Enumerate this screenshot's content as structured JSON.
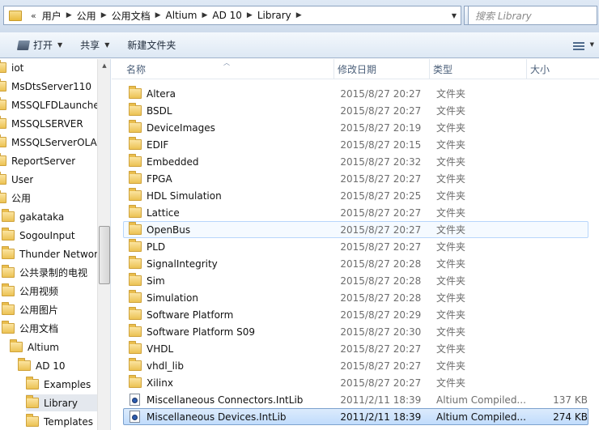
{
  "address_bar": {
    "overflow": "«",
    "breadcrumbs": [
      "用户",
      "公用",
      "公用文档",
      "Altium",
      "AD 10",
      "Library"
    ]
  },
  "search": {
    "placeholder": "搜索 Library"
  },
  "toolbar": {
    "open_label": "打开",
    "share_label": "共享",
    "new_folder_label": "新建文件夹"
  },
  "navigation": {
    "items": [
      {
        "label": "iot",
        "indent": 0,
        "selected": false
      },
      {
        "label": "MsDtsServer110",
        "indent": 0,
        "selected": false
      },
      {
        "label": "MSSQLFDLauncher",
        "indent": 0,
        "selected": false
      },
      {
        "label": "MSSQLSERVER",
        "indent": 0,
        "selected": false
      },
      {
        "label": "MSSQLServerOLAP",
        "indent": 0,
        "selected": false
      },
      {
        "label": "ReportServer",
        "indent": 0,
        "selected": false
      },
      {
        "label": "User",
        "indent": 0,
        "selected": false
      },
      {
        "label": "公用",
        "indent": 0,
        "selected": false
      },
      {
        "label": "gakataka",
        "indent": 1,
        "selected": false
      },
      {
        "label": "SogouInput",
        "indent": 1,
        "selected": false
      },
      {
        "label": "Thunder Network",
        "indent": 1,
        "selected": false
      },
      {
        "label": "公共录制的电视",
        "indent": 1,
        "selected": false
      },
      {
        "label": "公用视频",
        "indent": 1,
        "selected": false
      },
      {
        "label": "公用图片",
        "indent": 1,
        "selected": false
      },
      {
        "label": "公用文档",
        "indent": 1,
        "selected": false
      },
      {
        "label": "Altium",
        "indent": 2,
        "selected": false
      },
      {
        "label": "AD 10",
        "indent": 3,
        "selected": false
      },
      {
        "label": "Examples",
        "indent": 4,
        "selected": false
      },
      {
        "label": "Library",
        "indent": 4,
        "selected": true
      },
      {
        "label": "Templates",
        "indent": 4,
        "selected": false
      }
    ]
  },
  "columns": {
    "name": "名称",
    "date": "修改日期",
    "type": "类型",
    "size": "大小"
  },
  "files": [
    {
      "name": "Altera",
      "date": "2015/8/27 20:27",
      "type": "文件夹",
      "size": "",
      "kind": "folder",
      "state": ""
    },
    {
      "name": "BSDL",
      "date": "2015/8/27 20:27",
      "type": "文件夹",
      "size": "",
      "kind": "folder",
      "state": ""
    },
    {
      "name": "DeviceImages",
      "date": "2015/8/27 20:19",
      "type": "文件夹",
      "size": "",
      "kind": "folder",
      "state": ""
    },
    {
      "name": "EDIF",
      "date": "2015/8/27 20:15",
      "type": "文件夹",
      "size": "",
      "kind": "folder",
      "state": ""
    },
    {
      "name": "Embedded",
      "date": "2015/8/27 20:32",
      "type": "文件夹",
      "size": "",
      "kind": "folder",
      "state": ""
    },
    {
      "name": "FPGA",
      "date": "2015/8/27 20:27",
      "type": "文件夹",
      "size": "",
      "kind": "folder",
      "state": ""
    },
    {
      "name": "HDL Simulation",
      "date": "2015/8/27 20:25",
      "type": "文件夹",
      "size": "",
      "kind": "folder",
      "state": ""
    },
    {
      "name": "Lattice",
      "date": "2015/8/27 20:27",
      "type": "文件夹",
      "size": "",
      "kind": "folder",
      "state": ""
    },
    {
      "name": "OpenBus",
      "date": "2015/8/27 20:27",
      "type": "文件夹",
      "size": "",
      "kind": "folder",
      "state": "hover"
    },
    {
      "name": "PLD",
      "date": "2015/8/27 20:27",
      "type": "文件夹",
      "size": "",
      "kind": "folder",
      "state": ""
    },
    {
      "name": "SignalIntegrity",
      "date": "2015/8/27 20:28",
      "type": "文件夹",
      "size": "",
      "kind": "folder",
      "state": ""
    },
    {
      "name": "Sim",
      "date": "2015/8/27 20:28",
      "type": "文件夹",
      "size": "",
      "kind": "folder",
      "state": ""
    },
    {
      "name": "Simulation",
      "date": "2015/8/27 20:28",
      "type": "文件夹",
      "size": "",
      "kind": "folder",
      "state": ""
    },
    {
      "name": "Software Platform",
      "date": "2015/8/27 20:29",
      "type": "文件夹",
      "size": "",
      "kind": "folder",
      "state": ""
    },
    {
      "name": "Software Platform S09",
      "date": "2015/8/27 20:30",
      "type": "文件夹",
      "size": "",
      "kind": "folder",
      "state": ""
    },
    {
      "name": "VHDL",
      "date": "2015/8/27 20:27",
      "type": "文件夹",
      "size": "",
      "kind": "folder",
      "state": ""
    },
    {
      "name": "vhdl_lib",
      "date": "2015/8/27 20:27",
      "type": "文件夹",
      "size": "",
      "kind": "folder",
      "state": ""
    },
    {
      "name": "Xilinx",
      "date": "2015/8/27 20:27",
      "type": "文件夹",
      "size": "",
      "kind": "folder",
      "state": ""
    },
    {
      "name": "Miscellaneous Connectors.IntLib",
      "date": "2011/2/11 18:39",
      "type": "Altium Compiled...",
      "size": "137 KB",
      "kind": "file",
      "state": ""
    },
    {
      "name": "Miscellaneous Devices.IntLib",
      "date": "2011/2/11 18:39",
      "type": "Altium Compiled...",
      "size": "274 KB",
      "kind": "file",
      "state": "selected"
    }
  ]
}
